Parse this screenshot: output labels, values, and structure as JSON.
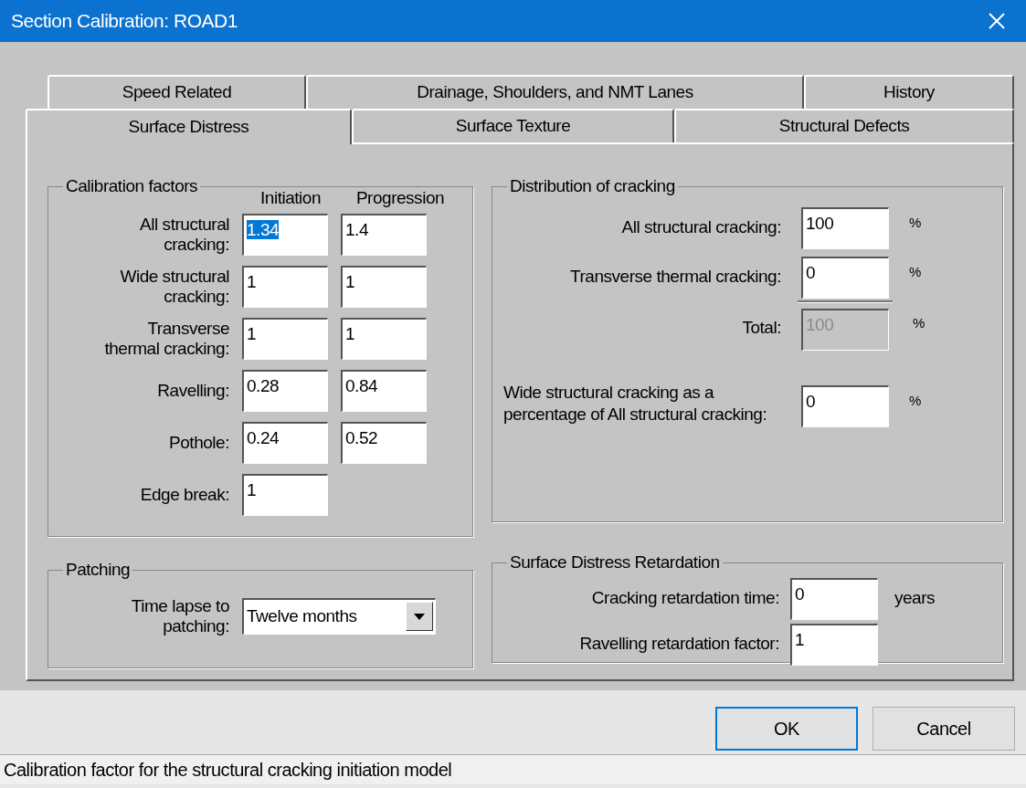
{
  "window": {
    "title": "Section Calibration: ROAD1"
  },
  "tab_rows": [
    [
      {
        "label": "Speed Related",
        "selected": false
      },
      {
        "label": "Drainage, Shoulders, and NMT Lanes",
        "selected": false
      },
      {
        "label": "History",
        "selected": false
      }
    ],
    [
      {
        "label": "Surface Distress",
        "selected": true
      },
      {
        "label": "Surface Texture",
        "selected": false
      },
      {
        "label": "Structural Defects",
        "selected": false
      }
    ]
  ],
  "calibration": {
    "title": "Calibration factors",
    "columns": [
      "Initiation",
      "Progression"
    ],
    "rows": [
      {
        "label": "All structural\ncracking:",
        "values": [
          {
            "value": "1.34",
            "selected": true
          },
          {
            "value": "1.4",
            "selected": false
          }
        ]
      },
      {
        "label": "Wide structural\ncracking:",
        "values": [
          {
            "value": "1",
            "selected": false
          },
          {
            "value": "1",
            "selected": false
          }
        ]
      },
      {
        "label": "Transverse\nthermal cracking:",
        "values": [
          {
            "value": "1",
            "selected": false
          },
          {
            "value": "1",
            "selected": false
          }
        ]
      },
      {
        "label": "Ravelling:",
        "values": [
          {
            "value": "0.28",
            "selected": false
          },
          {
            "value": "0.84",
            "selected": false
          }
        ]
      },
      {
        "label": "Pothole:",
        "values": [
          {
            "value": "0.24",
            "selected": false
          },
          {
            "value": "0.52",
            "selected": false
          }
        ]
      },
      {
        "label": "Edge break:",
        "values": [
          {
            "value": "1",
            "selected": false
          }
        ]
      }
    ]
  },
  "patching": {
    "title": "Patching",
    "label": "Time lapse to\npatching:",
    "value": "Twelve months"
  },
  "distribution": {
    "title": "Distribution of cracking",
    "rows": [
      {
        "label": "All structural cracking:",
        "value": "100",
        "unit": "%",
        "disabled": false,
        "kind": "field"
      },
      {
        "label": "Transverse thermal cracking:",
        "value": "0",
        "unit": "%",
        "disabled": false,
        "kind": "field"
      },
      {
        "label": "Total:",
        "value": "100",
        "unit": "%",
        "disabled": true,
        "kind": "total"
      },
      {
        "label": "Wide structural cracking as a percentage of All structural cracking:",
        "value": "0",
        "unit": "%",
        "disabled": false,
        "kind": "long"
      }
    ]
  },
  "retardation": {
    "title": "Surface Distress Retardation",
    "rows": [
      {
        "label": "Cracking retardation time:",
        "value": "0",
        "unit": "years"
      },
      {
        "label": "Ravelling retardation factor:",
        "value": "1"
      }
    ]
  },
  "buttons": [
    "OK",
    "Cancel"
  ],
  "status_bar": "Calibration factor for the structural cracking initiation model"
}
